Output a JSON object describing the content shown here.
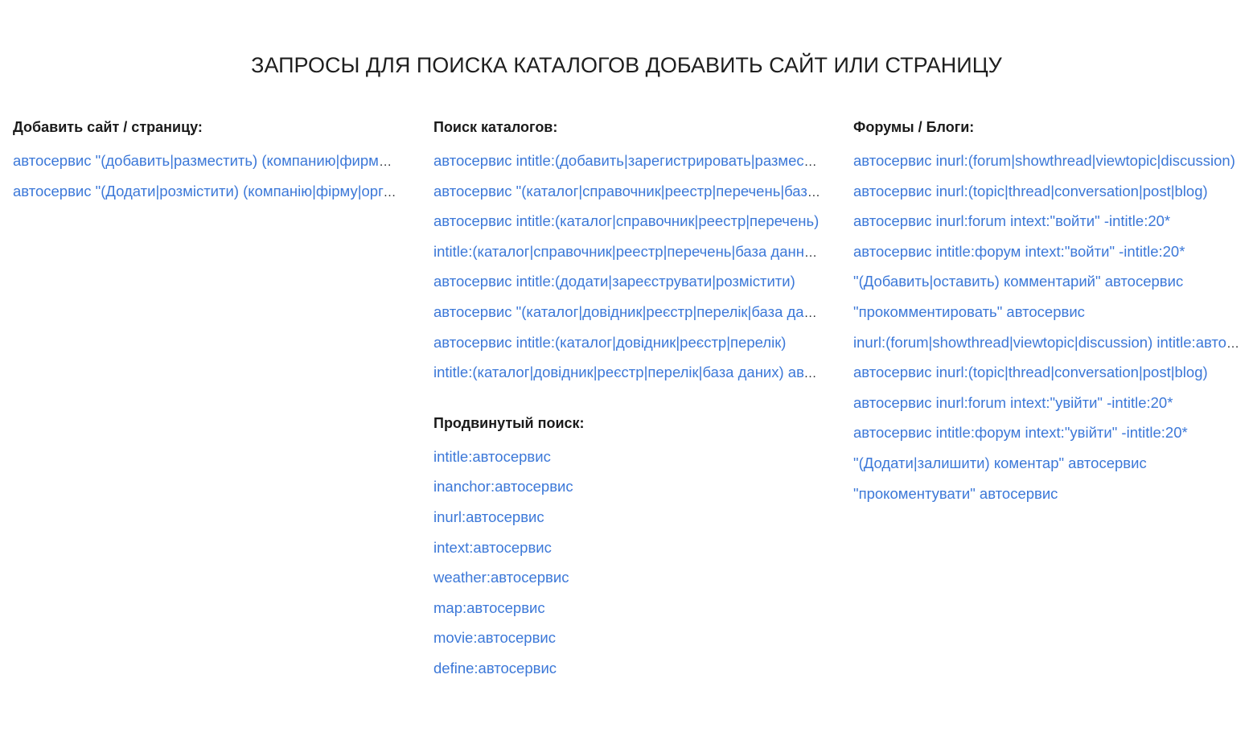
{
  "page": {
    "title": "ЗАПРОСЫ ДЛЯ ПОИСКА КАТАЛОГОВ ДОБАВИТЬ САЙТ ИЛИ СТРАНИЦУ"
  },
  "colors": {
    "link": "#3c78d8",
    "heading": "#1a1a1a"
  },
  "add_site": {
    "heading": "Добавить сайт / страницу:",
    "links": [
      "автосервис \"(добавить|разместить) (компанию|фирму|организацию)\"",
      "автосервис \"(Додати|розмістити) (компанію|фірму|організацію)\""
    ]
  },
  "catalog_search": {
    "heading": "Поиск каталогов:",
    "links": [
      "автосервис intitle:(добавить|зарегистрировать|разместить)",
      "автосервис \"(каталог|справочник|реестр|перечень|база данных)\"",
      "автосервис intitle:(каталог|справочник|реестр|перечень)",
      "intitle:(каталог|справочник|реестр|перечень|база данных) автосервис",
      "автосервис intitle:(додати|зареєструвати|розмістити)",
      "автосервис \"(каталог|довідник|реєстр|перелік|база даних)\"",
      "автосервис intitle:(каталог|довідник|реєстр|перелік)",
      "intitle:(каталог|довідник|реєстр|перелік|база даних) автосервис"
    ]
  },
  "advanced_search": {
    "heading": "Продвинутый поиск:",
    "links": [
      "intitle:автосервис",
      "inanchor:автосервис",
      "inurl:автосервис",
      "intext:автосервис",
      "weather:автосервис",
      "map:автосервис",
      "movie:автосервис",
      "define:автосервис"
    ]
  },
  "forums_blogs": {
    "heading": "Форумы / Блоги:",
    "links": [
      "автосервис inurl:(forum|showthread|viewtopic|discussion)",
      "автосервис inurl:(topic|thread|conversation|post|blog)",
      "автосервис inurl:forum intext:\"войти\" -intitle:20*",
      "автосервис intitle:форум intext:\"войти\" -intitle:20*",
      "\"(Добавить|оставить) комментарий\" автосервис",
      "\"прокомментировать\" автосервис",
      "inurl:(forum|showthread|viewtopic|discussion) intitle:автосервис",
      "автосервис inurl:(topic|thread|conversation|post|blog)",
      "автосервис inurl:forum intext:\"увійти\" -intitle:20*",
      "автосервис intitle:форум intext:\"увійти\" -intitle:20*",
      "\"(Додати|залишити) коментар\" автосервис",
      "\"прокоментувати\" автосервис"
    ]
  }
}
